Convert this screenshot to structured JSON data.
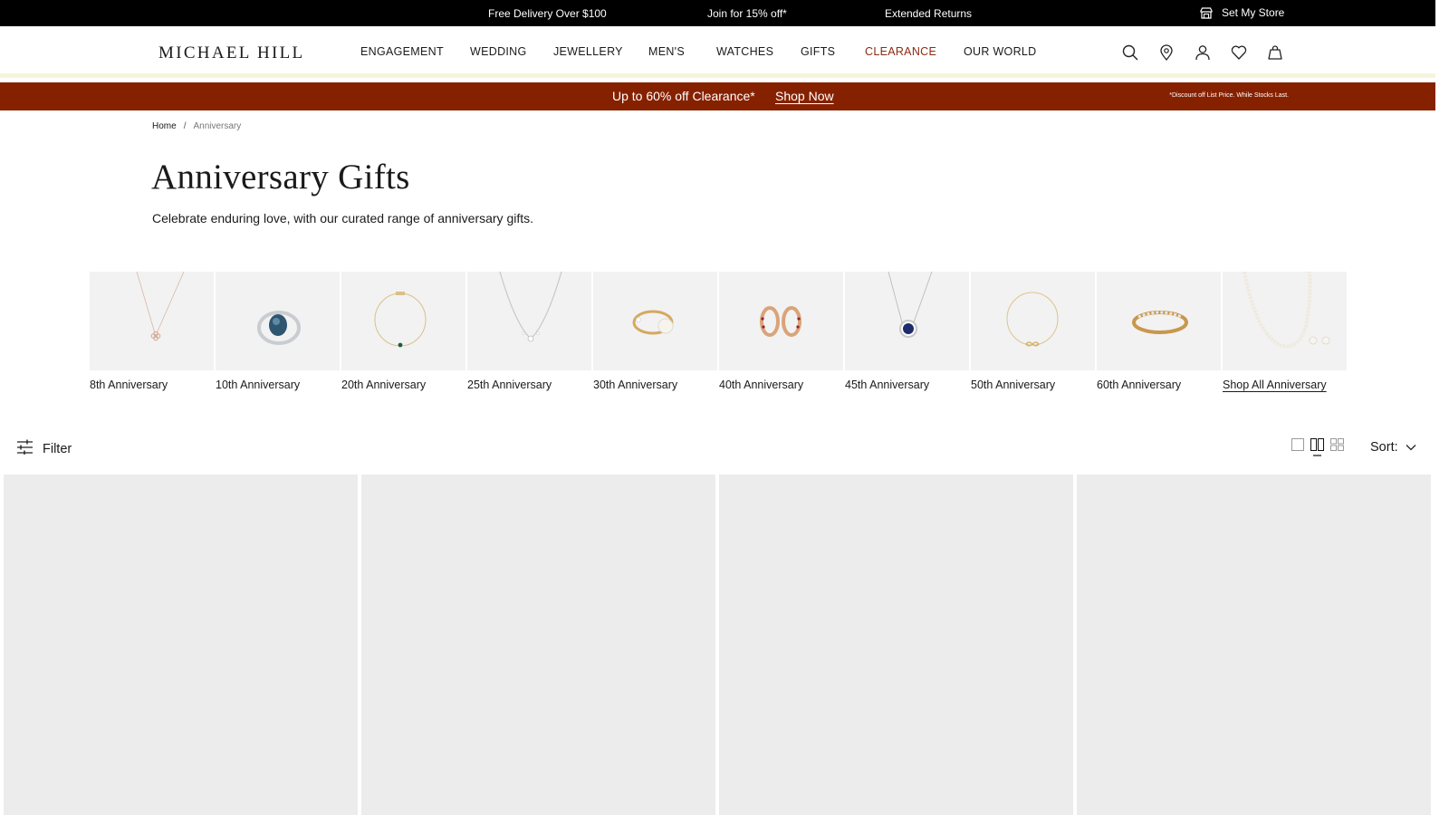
{
  "topbar": {
    "messages": [
      "Free Delivery Over $100",
      "Join for 15% off*",
      "Extended Returns"
    ],
    "store_label": "Set My Store",
    "store_icon": "store-icon"
  },
  "header": {
    "logo": "MICHAEL HILL",
    "nav": [
      "ENGAGEMENT",
      "WEDDING",
      "JEWELLERY",
      "MEN'S",
      "WATCHES",
      "GIFTS",
      "CLEARANCE",
      "OUR WORLD"
    ],
    "icons": [
      "search-icon",
      "location-pin-icon",
      "account-icon",
      "wishlist-heart-icon",
      "shopping-bag-icon"
    ],
    "clearance_color": "#8a2a12"
  },
  "promo": {
    "text": "Up to 60% off Clearance*",
    "link": "Shop Now",
    "note": "*Discount off List Price. While Stocks Last.",
    "background": "#862100"
  },
  "breadcrumb": {
    "home": "Home",
    "separator": "/",
    "current": "Anniversary"
  },
  "page": {
    "title": "Anniversary Gifts",
    "description": "Celebrate enduring love, with our curated range of anniversary gifts."
  },
  "categories": [
    {
      "label": "8th Anniversary",
      "image": "rose-gold-pendant-necklace"
    },
    {
      "label": "10th Anniversary",
      "image": "blue-topaz-ring"
    },
    {
      "label": "20th Anniversary",
      "image": "gold-emerald-bracelet"
    },
    {
      "label": "25th Anniversary",
      "image": "silver-diamond-necklace"
    },
    {
      "label": "30th Anniversary",
      "image": "gold-pearl-ring"
    },
    {
      "label": "40th Anniversary",
      "image": "ruby-hoop-earrings"
    },
    {
      "label": "45th Anniversary",
      "image": "sapphire-halo-pendant"
    },
    {
      "label": "50th Anniversary",
      "image": "gold-infinity-bracelet"
    },
    {
      "label": "60th Anniversary",
      "image": "gold-diamond-ring"
    },
    {
      "label": "Shop All Anniversary",
      "image": "pearl-necklace-and-earrings"
    }
  ],
  "toolbar": {
    "filter_label": "Filter",
    "filter_icon": "filter-sliders-icon",
    "views": [
      "single-column-view-icon",
      "two-column-view-icon",
      "four-column-view-icon"
    ],
    "active_view": "two-column-view-icon",
    "sort_label": "Sort:"
  },
  "products": [
    {},
    {},
    {},
    {}
  ]
}
